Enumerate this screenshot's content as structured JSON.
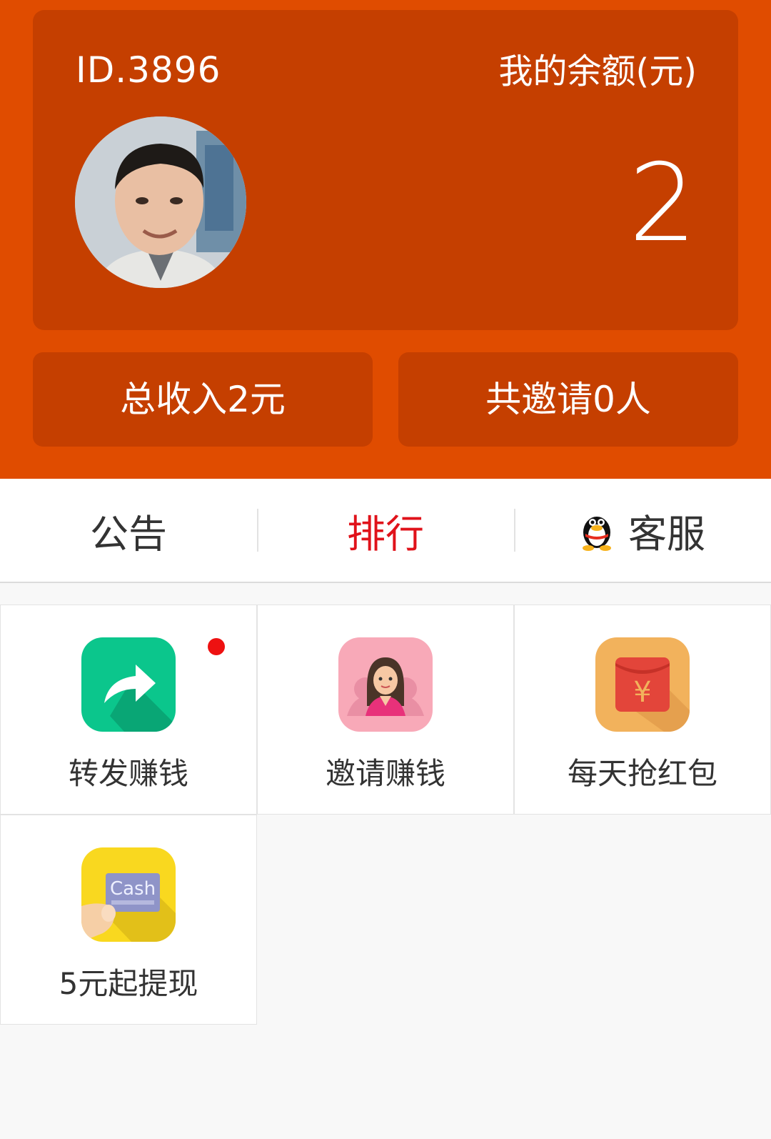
{
  "header": {
    "user_id": "ID.3896",
    "balance_label": "我的余额(元)",
    "balance_value": "2",
    "total_income": "总收入2元",
    "invited_count": "共邀请0人"
  },
  "tabs": [
    {
      "label": "公告",
      "active": false
    },
    {
      "label": "排行",
      "active": true
    },
    {
      "label": "客服",
      "active": false,
      "icon": "qq-penguin-icon"
    }
  ],
  "grid": [
    {
      "label": "转发赚钱",
      "icon": "share-forward-icon",
      "color": "#0bc68c",
      "badge": true
    },
    {
      "label": "邀请赚钱",
      "icon": "invite-person-icon",
      "color": "#f8a9b8",
      "badge": false
    },
    {
      "label": "每天抢红包",
      "icon": "red-envelope-icon",
      "color": "#f2b25c",
      "badge": false
    },
    {
      "label": "5元起提现",
      "icon": "cash-card-icon",
      "color": "#f9d81f",
      "badge": false,
      "icon_text": "Cash"
    }
  ],
  "colors": {
    "header_bg": "#e04c00",
    "card_bg": "#c53f00",
    "active_tab": "#e0121a",
    "badge_dot": "#ee1111"
  }
}
